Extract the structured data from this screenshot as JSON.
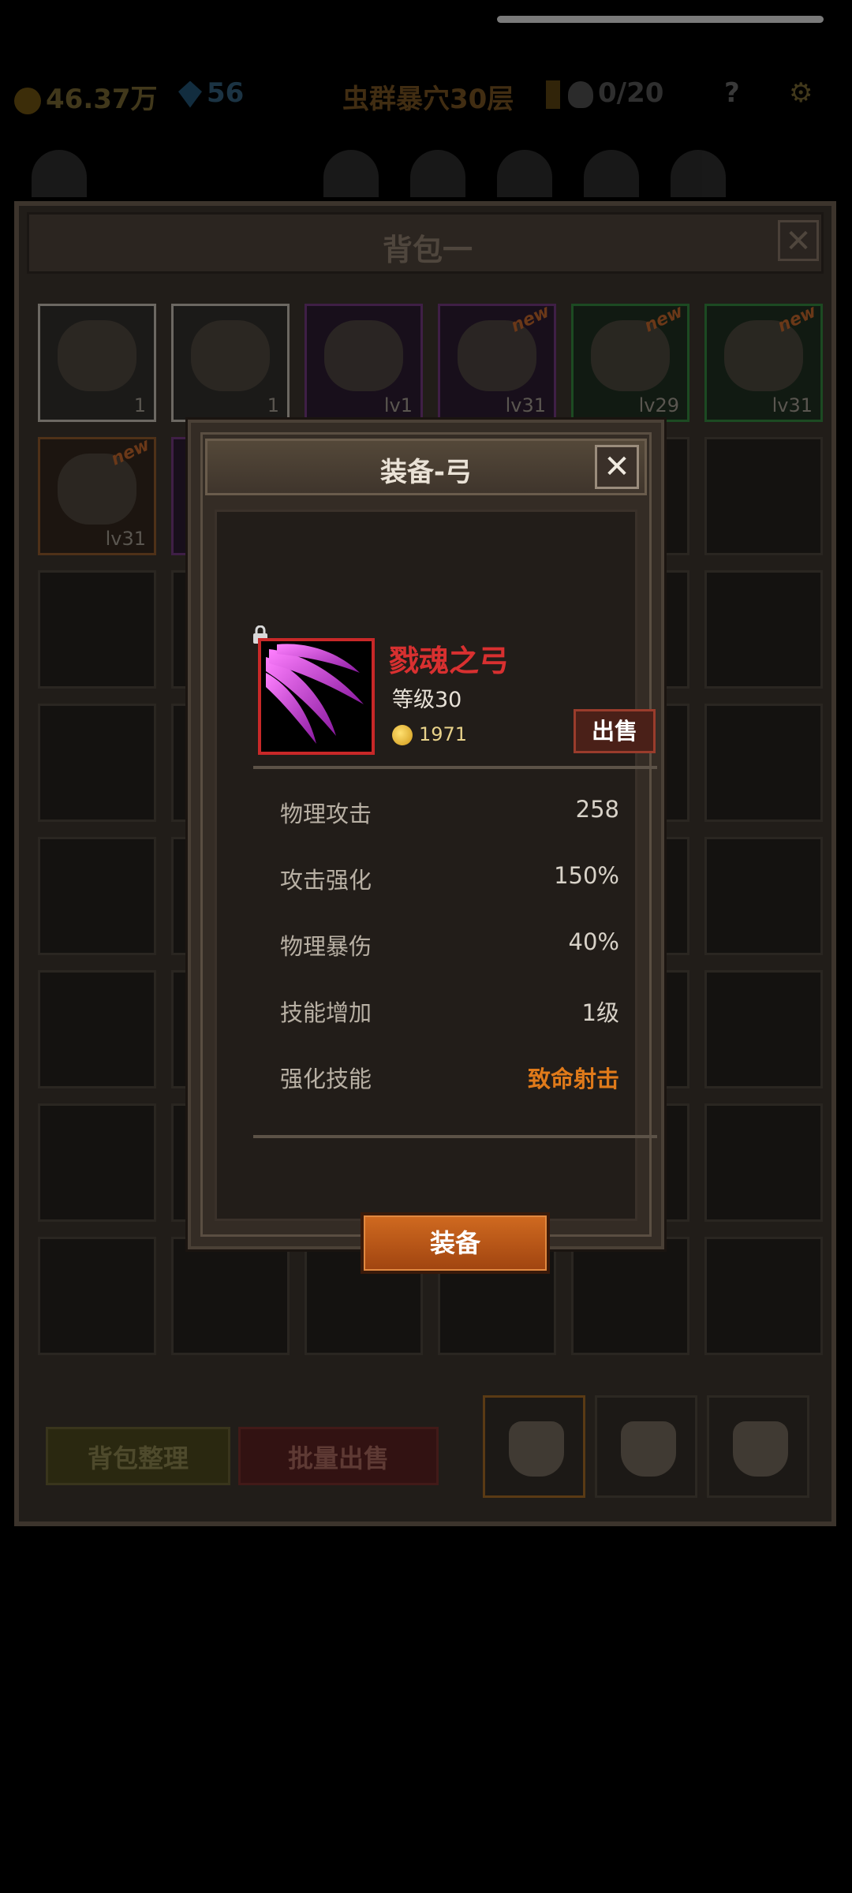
{
  "topbar": {
    "gold": "46.37万",
    "gems": "56",
    "stage": "虫群暴穴30层",
    "keys": "0/20",
    "help": "?"
  },
  "bag": {
    "title": "背包一",
    "close": "✕",
    "slots": [
      {
        "rarity": "white",
        "label": "1",
        "art": "cake-icon",
        "new": false
      },
      {
        "rarity": "white",
        "label": "1",
        "art": "beer-mug-icon",
        "new": false
      },
      {
        "rarity": "purple",
        "label": "lv1",
        "art": "armor-icon",
        "new": false
      },
      {
        "rarity": "purple",
        "label": "lv31",
        "art": "armor-icon",
        "new": true
      },
      {
        "rarity": "green",
        "label": "lv29",
        "art": "helmet-icon",
        "new": true
      },
      {
        "rarity": "green",
        "label": "lv31",
        "art": "gloves-icon",
        "new": true
      },
      {
        "rarity": "orange",
        "label": "lv31",
        "art": "sword-icon",
        "new": true
      },
      {
        "rarity": "purple",
        "label": "",
        "art": "item-icon",
        "new": false
      }
    ],
    "new_badge": "new",
    "sort_button": "背包整理",
    "bulk_sell_button": "批量出售"
  },
  "modal": {
    "title": "装备-弓",
    "close": "✕",
    "item": {
      "name": "戮魂之弓",
      "level": "等级30",
      "price": "1971",
      "sell_button": "出售",
      "icon": "bow-claw-icon"
    },
    "stats": [
      {
        "label": "物理攻击",
        "value": "258"
      },
      {
        "label": "攻击强化",
        "value": "150%"
      },
      {
        "label": "物理暴伤",
        "value": "40%"
      },
      {
        "label": "技能增加",
        "value": "1级"
      },
      {
        "label": "强化技能",
        "value": "致命射击"
      }
    ],
    "equip_button": "装备"
  },
  "colors": {
    "item_name": "#d83030",
    "skill_value": "#e07a1a",
    "equip_button": "#c05a18",
    "frame_red": "#c82828"
  }
}
